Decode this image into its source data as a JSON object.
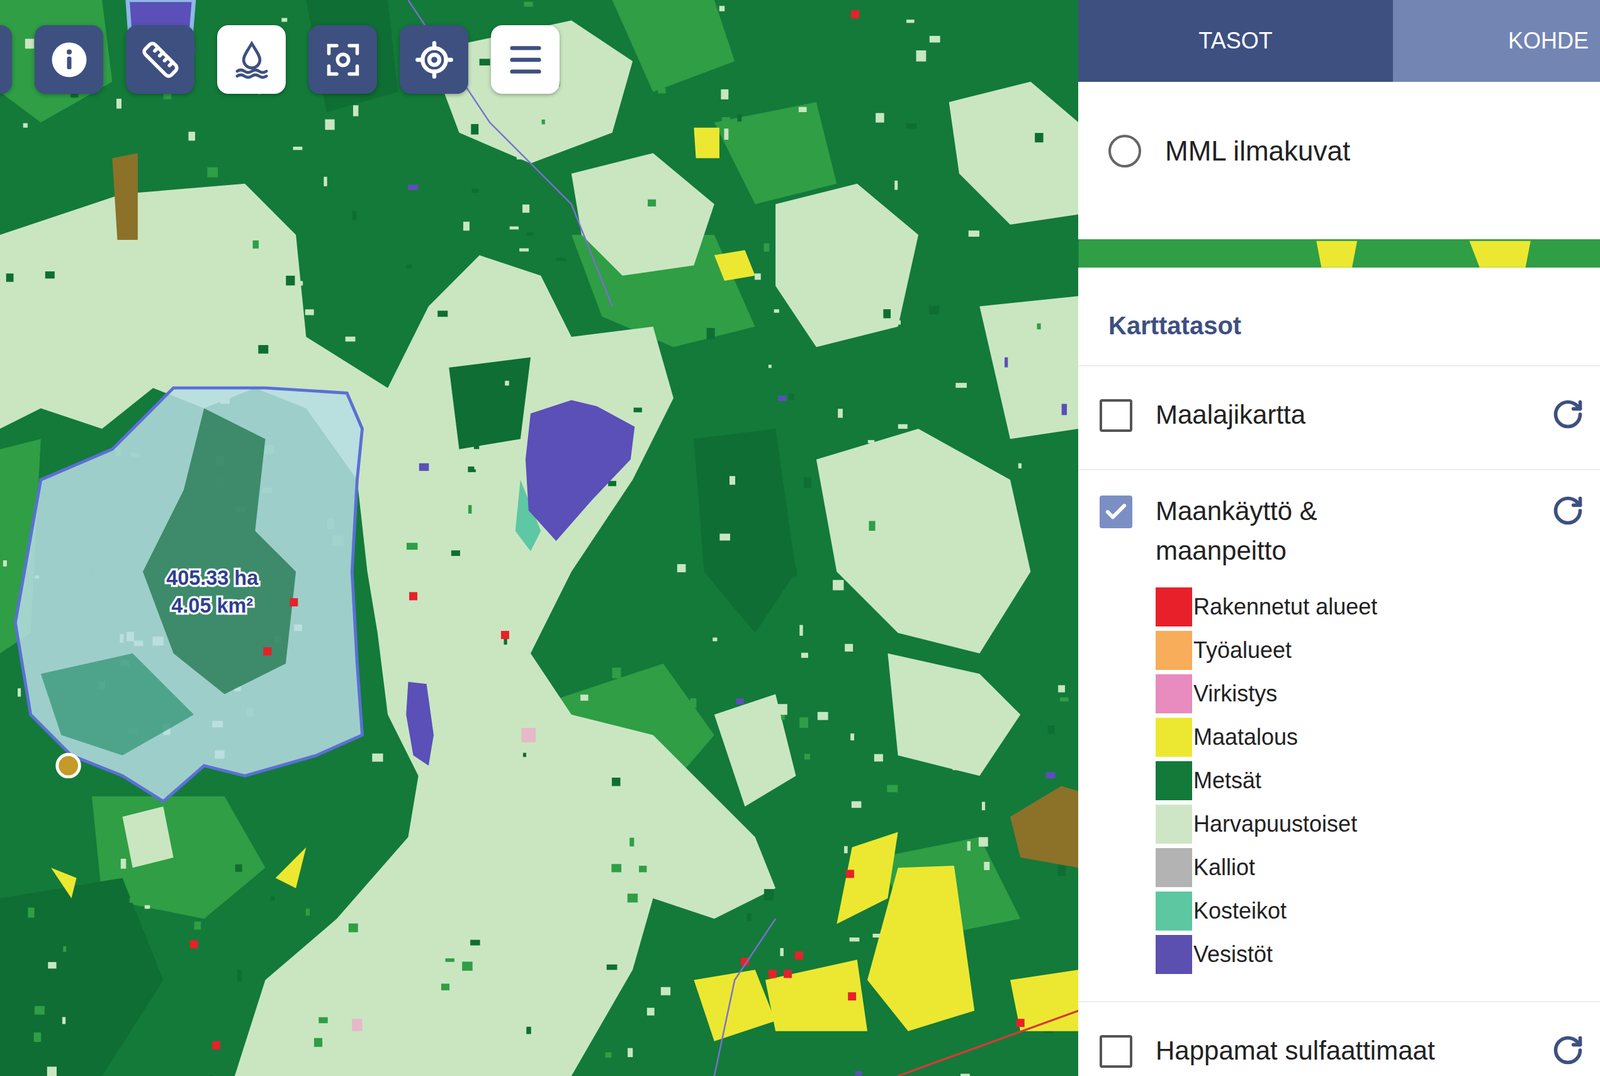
{
  "map": {
    "area_label": {
      "hectares": "405.33 ha",
      "square_km": "4.05 km²"
    }
  },
  "tabs": [
    {
      "label": "TASOT",
      "selected": true
    },
    {
      "label": "KOHDE",
      "selected": false
    }
  ],
  "basemaps": [
    {
      "label": "MML ilmakuvat",
      "selected": false
    }
  ],
  "layers_panel": {
    "title": "Karttatasot",
    "layers": [
      {
        "lines": [
          "Maalajikartta"
        ],
        "checked": false,
        "legend": []
      },
      {
        "lines": [
          "Maankäyttö &",
          "maanpeitto"
        ],
        "checked": true,
        "legend": [
          {
            "label": "Rakennetut alueet",
            "color": "#e8202a"
          },
          {
            "label": "Työalueet",
            "color": "#f7ad5a"
          },
          {
            "label": "Virkistys",
            "color": "#e88bbf"
          },
          {
            "label": "Maatalous",
            "color": "#ece831"
          },
          {
            "label": "Metsät",
            "color": "#137a3a"
          },
          {
            "label": "Harvapuustoiset",
            "color": "#cfe6c6"
          },
          {
            "label": "Kalliot",
            "color": "#b3b3b3"
          },
          {
            "label": "Kosteikot",
            "color": "#5cc7a0"
          },
          {
            "label": "Vesistöt",
            "color": "#5b4fb0"
          }
        ]
      },
      {
        "lines": [
          "Happamat sulfaattimaat"
        ],
        "checked": false,
        "legend": []
      }
    ]
  }
}
